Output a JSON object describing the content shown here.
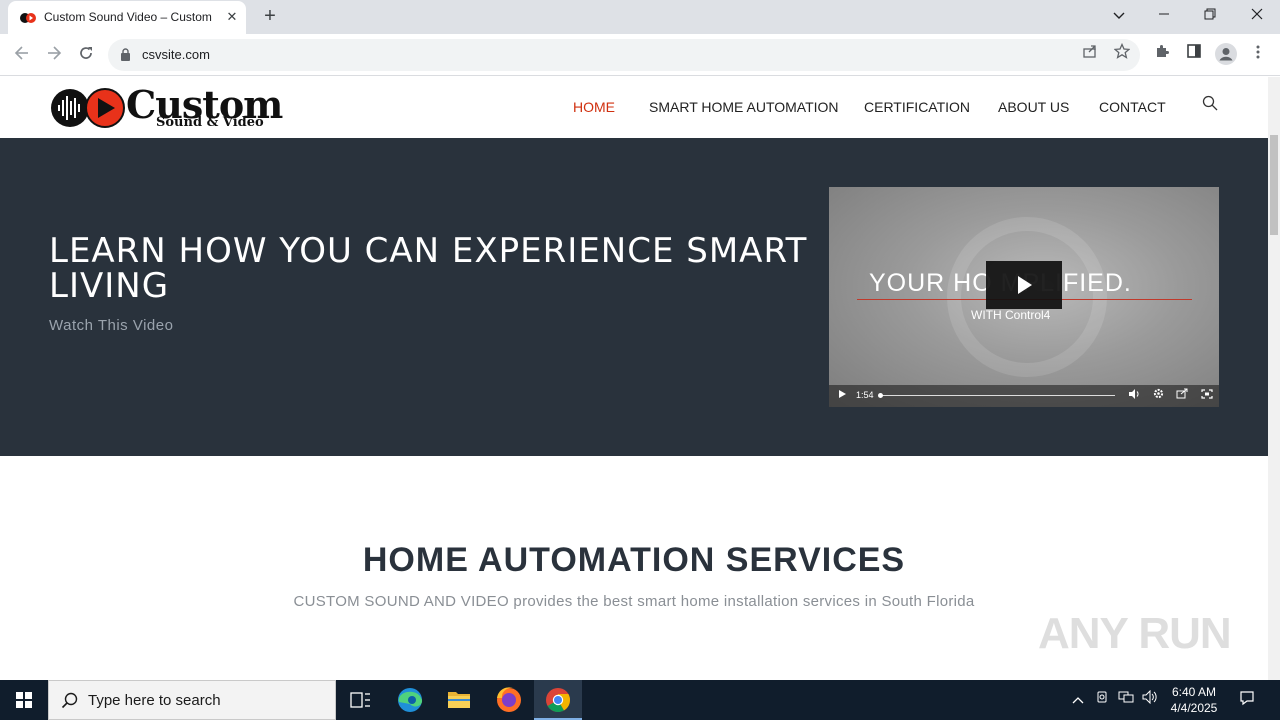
{
  "browser": {
    "tab_title": "Custom Sound Video – Custom",
    "url": "csvsite.com"
  },
  "site": {
    "logo": {
      "wordmark": "Custom",
      "tagline": "Sound & Video"
    },
    "nav": [
      {
        "label": "HOME",
        "active": true
      },
      {
        "label": "SMART HOME AUTOMATION",
        "active": false
      },
      {
        "label": "CERTIFICATION",
        "active": false
      },
      {
        "label": "ABOUT US",
        "active": false
      },
      {
        "label": "CONTACT",
        "active": false
      }
    ],
    "accent_color": "#d0300f",
    "hero": {
      "title": "LEARN HOW YOU CAN EXPERIENCE SMART LIVING",
      "subtitle": "Watch This Video",
      "background": "#29323c",
      "video": {
        "overlay_text": "YOUR HO    MPLIFIED.",
        "with_text": "WITH  Control4",
        "duration": "1:54"
      }
    },
    "services": {
      "title": "HOME AUTOMATION SERVICES",
      "subtitle": "CUSTOM SOUND AND VIDEO provides the best smart home installation services in South Florida"
    }
  },
  "watermark": "ANY RUN",
  "taskbar": {
    "search_placeholder": "Type here to search",
    "time": "6:40 AM",
    "date": "4/4/2025"
  }
}
